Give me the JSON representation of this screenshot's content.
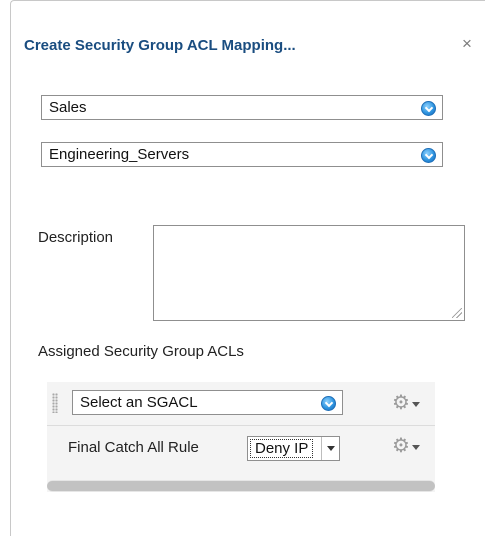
{
  "dialog": {
    "title": "Create Security Group ACL Mapping...",
    "close_glyph": "×"
  },
  "source_group": {
    "value": "Sales"
  },
  "destination_group": {
    "value": "Engineering_Servers"
  },
  "description": {
    "label": "Description",
    "value": ""
  },
  "acls": {
    "section_label": "Assigned Security Group ACLs",
    "select_placeholder": "Select an SGACL",
    "final_rule_label": "Final Catch All Rule",
    "final_rule_value": "Deny IP"
  },
  "icons": {
    "dropdown": "chevron-down-circle-icon",
    "gear": "gear-icon",
    "drag": "drag-handle-icon",
    "resize": "resize-grip-icon"
  },
  "colors": {
    "title": "#1a4d80",
    "dropdown_accent": "#2f95e0"
  }
}
